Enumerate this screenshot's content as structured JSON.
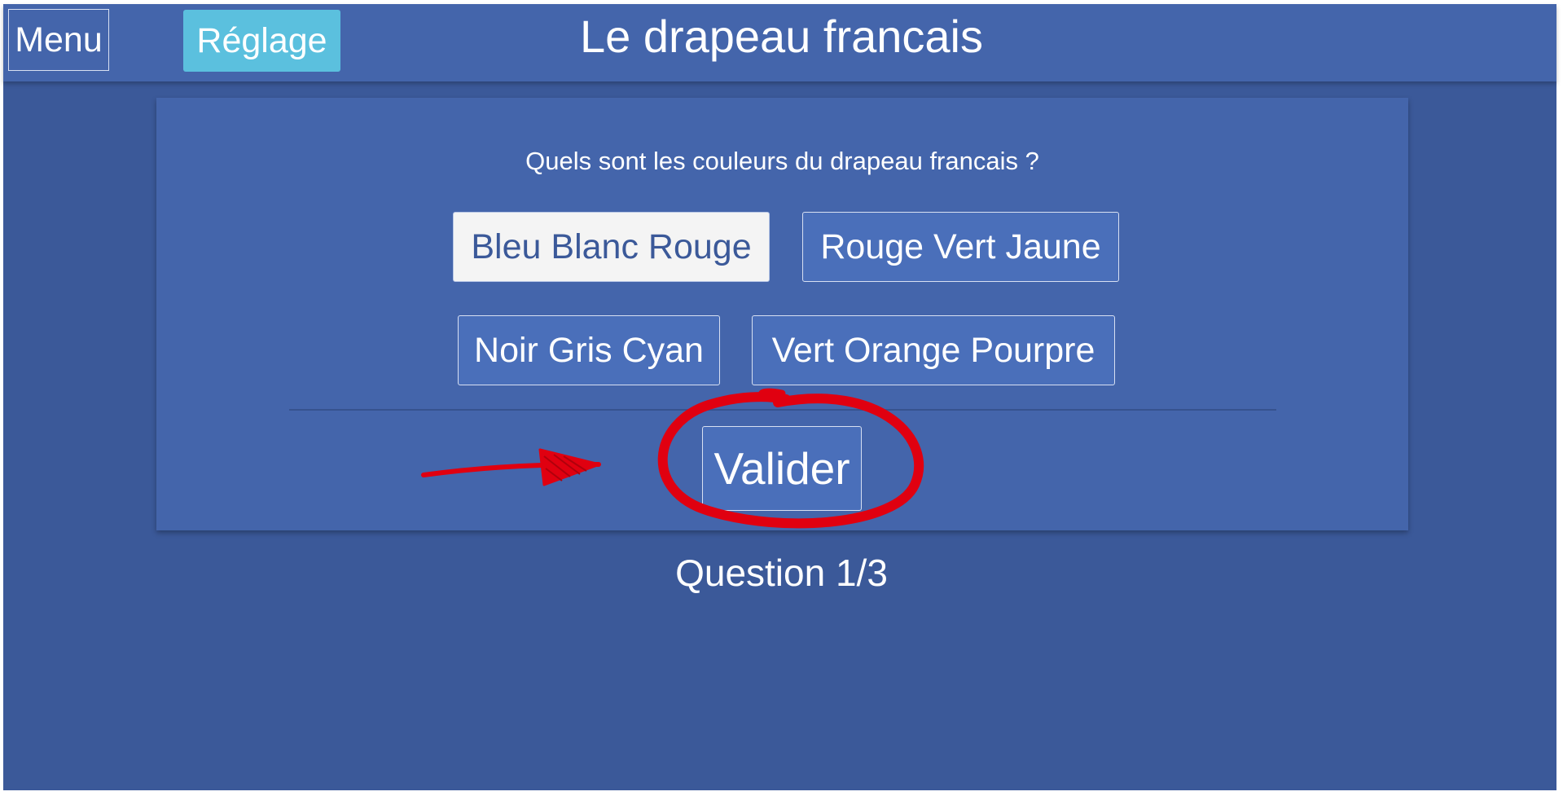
{
  "header": {
    "menu_label": "Menu",
    "settings_label": "Réglage",
    "title": "Le drapeau francais"
  },
  "quiz": {
    "question": "Quels sont les couleurs du drapeau francais ?",
    "answers": [
      {
        "label": "Bleu Blanc Rouge",
        "selected": true
      },
      {
        "label": "Rouge Vert Jaune",
        "selected": false
      },
      {
        "label": "Noir Gris Cyan",
        "selected": false
      },
      {
        "label": "Vert Orange Pourpre",
        "selected": false
      }
    ],
    "validate_label": "Valider",
    "progress": "Question 1/3"
  },
  "colors": {
    "background": "#3b5999",
    "bar": "#4465ab",
    "settings_button": "#5bc0de",
    "annotation": "#e00010"
  },
  "annotations": {
    "arrow": "arrow-right-icon",
    "circle": "circle-highlight-icon"
  }
}
